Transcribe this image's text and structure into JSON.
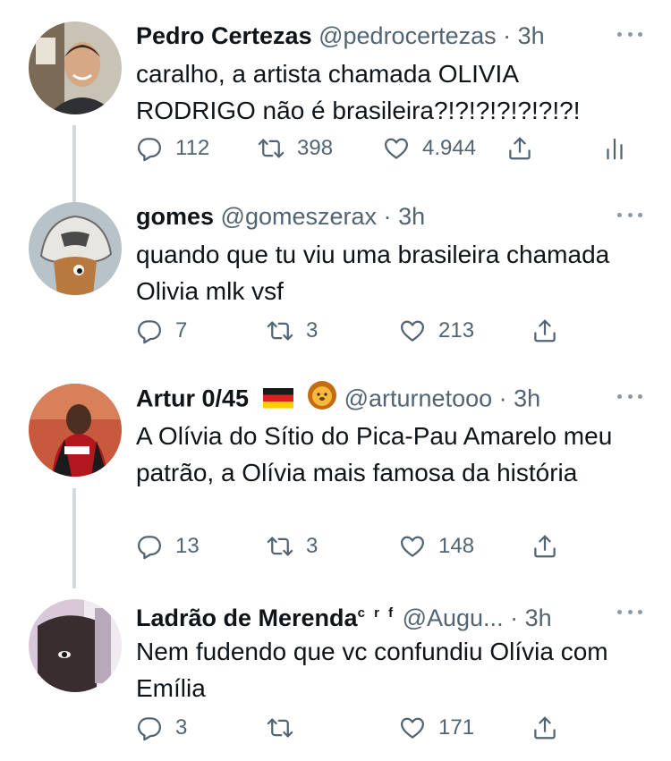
{
  "tweets": [
    {
      "name": "Pedro Certezas",
      "handle": "@pedrocertezas",
      "sep": "·",
      "time": "3h",
      "text": "caralho, a artista chamada OLIVIA RODRIGO não é brasileira?!?!?!?!?!?!?!",
      "replies": "112",
      "retweets": "398",
      "likes": "4.944",
      "has_analytics": true
    },
    {
      "name": "gomes",
      "handle": "@gomeszerax",
      "sep": "·",
      "time": "3h",
      "text": "quando que tu viu uma brasileira chamada Olivia mlk vsf",
      "replies": "7",
      "retweets": "3",
      "likes": "213"
    },
    {
      "name": "Artur 0/45",
      "handle": "@arturnetooo",
      "sep": "·",
      "time": "3h",
      "text": "A Olívia do Sítio do Pica-Pau Amarelo meu patrão, a Olívia mais famosa da história",
      "replies": "13",
      "retweets": "3",
      "likes": "148",
      "badges": [
        "german-flag-emoji",
        "lion-emoji"
      ]
    },
    {
      "name": "Ladrão de Merenda",
      "name_sup": "c r f",
      "handle": "@Augu...",
      "sep": "·",
      "time": "3h",
      "text": "Nem fudendo que vc confundiu Olívia com Emília",
      "replies": "3",
      "retweets": "",
      "likes": "171"
    }
  ],
  "colors": {
    "text": "#0f1419",
    "secondary": "#536471",
    "thread_line": "#cfd9de",
    "icon": "#536471"
  }
}
